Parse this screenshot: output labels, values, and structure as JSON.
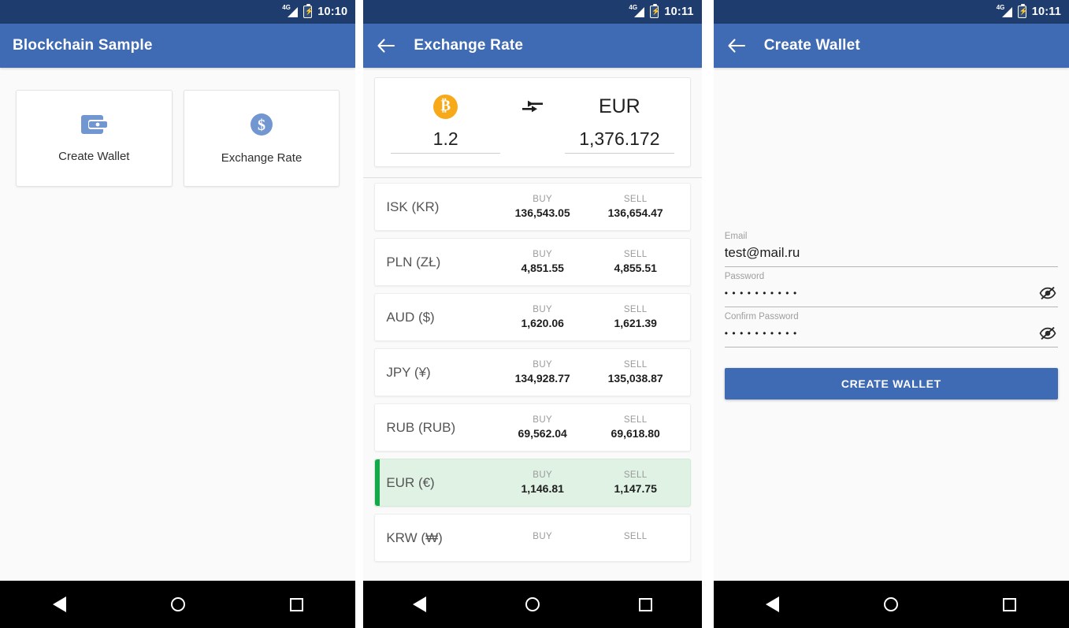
{
  "statusbar": {
    "network": "4G",
    "time_screen1": "10:10",
    "time_screen2": "10:11",
    "time_screen3": "10:11",
    "colors": {
      "status_bg": "#1f3c6e",
      "appbar_bg": "#3f6ab4"
    }
  },
  "screen1": {
    "title": "Blockchain Sample",
    "cards": [
      {
        "icon": "wallet-icon",
        "label": "Create Wallet"
      },
      {
        "icon": "dollar-circle-icon",
        "label": "Exchange Rate"
      }
    ]
  },
  "screen2": {
    "title": "Exchange Rate",
    "back_icon": "back-arrow-icon",
    "converter": {
      "from_icon": "bitcoin-icon",
      "from_symbol": "₿",
      "swap_icon": "swap-arrows-icon",
      "to_currency": "EUR",
      "from_value": "1.2",
      "to_value": "1,376.172"
    },
    "col_headers": {
      "buy": "BUY",
      "sell": "SELL"
    },
    "rates": [
      {
        "name": "ISK (KR)",
        "buy": "136,543.05",
        "sell": "136,654.47",
        "selected": false
      },
      {
        "name": "PLN (ZŁ)",
        "buy": "4,851.55",
        "sell": "4,855.51",
        "selected": false
      },
      {
        "name": "AUD ($)",
        "buy": "1,620.06",
        "sell": "1,621.39",
        "selected": false
      },
      {
        "name": "JPY (¥)",
        "buy": "134,928.77",
        "sell": "135,038.87",
        "selected": false
      },
      {
        "name": "RUB (RUB)",
        "buy": "69,562.04",
        "sell": "69,618.80",
        "selected": false
      },
      {
        "name": "EUR (€)",
        "buy": "1,146.81",
        "sell": "1,147.75",
        "selected": true
      },
      {
        "name": "KRW (₩)",
        "buy": "",
        "sell": "",
        "selected": false
      }
    ],
    "selected_accent": "#14a84a",
    "selected_bg": "#dff2e4"
  },
  "screen3": {
    "title": "Create Wallet",
    "back_icon": "back-arrow-icon",
    "fields": [
      {
        "label": "Email",
        "value": "test@mail.ru",
        "masked": false,
        "toggle_icon": ""
      },
      {
        "label": "Password",
        "value": "••••••••••",
        "masked": true,
        "toggle_icon": "eye-off-icon"
      },
      {
        "label": "Confirm Password",
        "value": "••••••••••",
        "masked": true,
        "toggle_icon": "eye-off-icon"
      }
    ],
    "submit_label": "CREATE WALLET"
  },
  "navbar": {
    "back": "back-nav-button",
    "home": "home-nav-button",
    "recents": "recents-nav-button"
  }
}
